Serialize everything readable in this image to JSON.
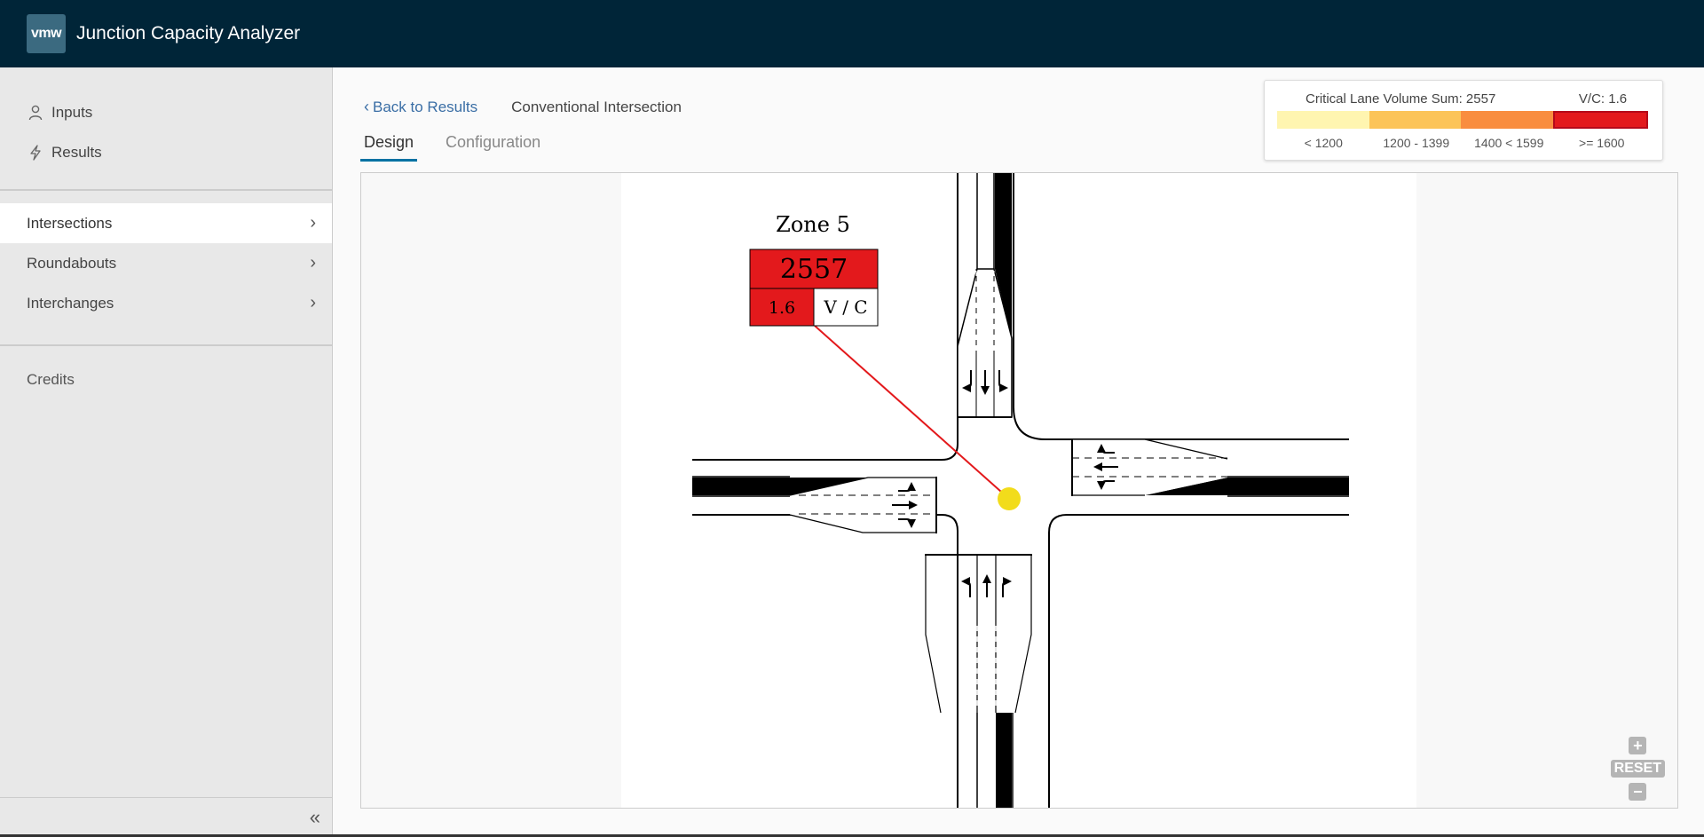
{
  "app": {
    "logo": "vmw",
    "title": "Junction Capacity Analyzer"
  },
  "sidebar": {
    "top_links": [
      {
        "label": "Inputs",
        "icon": "user-icon"
      },
      {
        "label": "Results",
        "icon": "lightning-icon"
      }
    ],
    "nav_items": [
      {
        "label": "Intersections",
        "active": true
      },
      {
        "label": "Roundabouts",
        "active": false
      },
      {
        "label": "Interchanges",
        "active": false
      }
    ],
    "credits": "Credits",
    "collapse_glyph": "«"
  },
  "main": {
    "back_label": "Back to Results",
    "page_title": "Conventional Intersection",
    "tabs": [
      {
        "label": "Design",
        "active": true
      },
      {
        "label": "Configuration",
        "active": false
      }
    ]
  },
  "legend": {
    "sum_text": "Critical Lane Volume Sum: 2557",
    "vc_text": "V/C: 1.6",
    "segments": [
      {
        "label": "< 1200",
        "color": "#fff5b0",
        "active": false
      },
      {
        "label": "1200 - 1399",
        "color": "#fcc459",
        "active": false
      },
      {
        "label": "1400 < 1599",
        "color": "#f98d3f",
        "active": false
      },
      {
        "label": ">= 1600",
        "color": "#e3191c",
        "active": true
      }
    ]
  },
  "diagram": {
    "zone_title": "Zone 5",
    "cls_value": "2557",
    "vc_value": "1.6",
    "vc_label": "V / C",
    "zone_color": "#e3191c",
    "marker_color": "#f2dc1b"
  },
  "zoom": {
    "plus": "+",
    "reset": "RESET",
    "minus": "−"
  }
}
